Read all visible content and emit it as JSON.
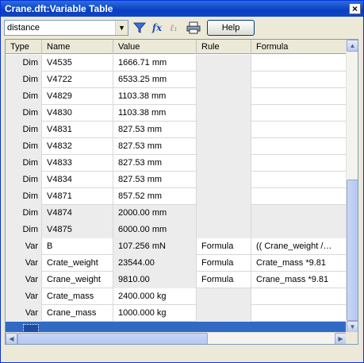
{
  "window": {
    "title": "Crane.dft:Variable Table",
    "close_glyph": "×"
  },
  "toolbar": {
    "filter_value": "distance",
    "help_label": "Help",
    "icons": [
      "filter-icon",
      "formula-fx-icon",
      "rule-icon",
      "print-icon"
    ]
  },
  "columns": [
    "Type",
    "Name",
    "Value",
    "Rule",
    "Formula"
  ],
  "rows": [
    {
      "type": "Dim",
      "name": "V4535",
      "value": "1666.71 mm",
      "rule": "",
      "formula": ""
    },
    {
      "type": "Dim",
      "name": "V4722",
      "value": "6533.25 mm",
      "rule": "",
      "formula": ""
    },
    {
      "type": "Dim",
      "name": "V4829",
      "value": "1103.38 mm",
      "rule": "",
      "formula": ""
    },
    {
      "type": "Dim",
      "name": "V4830",
      "value": "1103.38 mm",
      "rule": "",
      "formula": ""
    },
    {
      "type": "Dim",
      "name": "V4831",
      "value": "827.53 mm",
      "rule": "",
      "formula": ""
    },
    {
      "type": "Dim",
      "name": "V4832",
      "value": "827.53 mm",
      "rule": "",
      "formula": ""
    },
    {
      "type": "Dim",
      "name": "V4833",
      "value": "827.53 mm",
      "rule": "",
      "formula": ""
    },
    {
      "type": "Dim",
      "name": "V4834",
      "value": "827.53 mm",
      "rule": "",
      "formula": ""
    },
    {
      "type": "Dim",
      "name": "V4871",
      "value": "857.52 mm",
      "rule": "",
      "formula": ""
    },
    {
      "type": "Dim",
      "name": "V4874",
      "value": "2000.00 mm",
      "rule": "",
      "formula": ""
    },
    {
      "type": "Dim",
      "name": "V4875",
      "value": "6000.00 mm",
      "rule": "",
      "formula": ""
    },
    {
      "type": "Var",
      "name": "B",
      "value": "107.256 mN",
      "rule": "Formula",
      "formula": "(( Crane_weight /…"
    },
    {
      "type": "Var",
      "name": "Crate_weight",
      "value": "23544.00",
      "rule": "Formula",
      "formula": "Crate_mass *9.81"
    },
    {
      "type": "Var",
      "name": "Crane_weight",
      "value": "9810.00",
      "rule": "Formula",
      "formula": "Crane_mass *9.81"
    },
    {
      "type": "Var",
      "name": "Crate_mass",
      "value": "2400.000 kg",
      "rule": "",
      "formula": ""
    },
    {
      "type": "Var",
      "name": "Crane_mass",
      "value": "1000.000 kg",
      "rule": "",
      "formula": ""
    },
    {
      "type": "",
      "name": "",
      "value": "",
      "rule": "",
      "formula": ""
    }
  ],
  "colors": {
    "selection": "#316ac5",
    "title_bar": "#0a3fbf",
    "gray_cell": "#ececec"
  }
}
